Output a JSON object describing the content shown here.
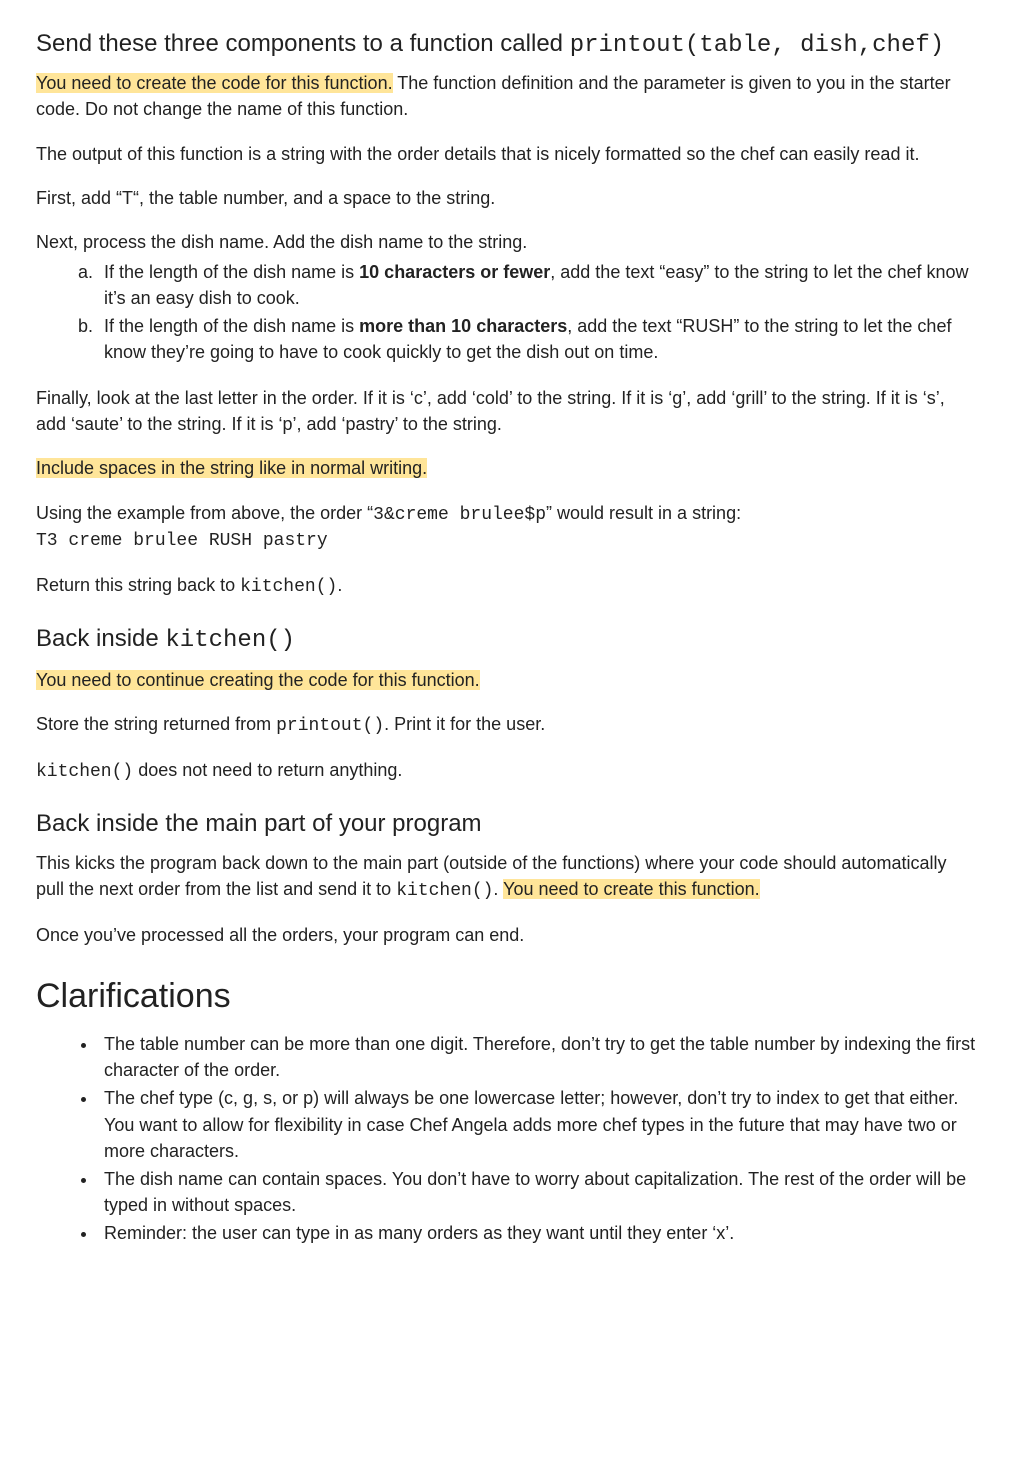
{
  "section1": {
    "title_pre": "Send these three components to a function called ",
    "title_code": "printout(table, dish,chef)",
    "p1_hl": "You need to create the code for this function.",
    "p1_rest": " The function definition and the parameter is given to you in the starter code. Do not change the name of this function.",
    "p2": "The output of this function is a string with the order details that is nicely formatted so the chef can easily read it.",
    "p3": "First, add “T“, the table number, and a space to the string.",
    "p4": "Next, process the dish name. Add the dish name to the string.",
    "li_a_pre": "If the length of the dish name is ",
    "li_a_bold": "10 characters or fewer",
    "li_a_post": ", add the text “easy” to the string to let the chef know it’s an easy dish to cook.",
    "li_b_pre": "If the length of the dish name is ",
    "li_b_bold": "more than 10 characters",
    "li_b_post": ", add the text “RUSH” to the string to let the chef know they’re going to have to cook quickly to get the dish out on time.",
    "p5": "Finally, look at the last letter in the order. If it is ‘c’, add ‘cold’ to the string. If it is ‘g’, add ‘grill’ to the string. If it is ‘s’, add ‘saute’ to the string. If it is ‘p’, add ‘pastry’ to the string.",
    "p6_hl": "Include spaces in the string like in normal writing.",
    "p7_pre": "Using the example from above, the order “",
    "p7_code": "3&creme brulee$p",
    "p7_post": "” would result in a string:",
    "p7_out": "T3 creme brulee RUSH pastry",
    "p8_pre": "Return this string back to ",
    "p8_code": "kitchen()",
    "p8_post": "."
  },
  "section2": {
    "title_pre": "Back inside ",
    "title_code": "kitchen()",
    "p1_hl": "You need to continue creating the code for this function.",
    "p2_pre": "Store the string returned from ",
    "p2_code": "printout()",
    "p2_post": ". Print it for the user.",
    "p3_code": "kitchen()",
    "p3_post": " does not need to return anything."
  },
  "section3": {
    "title": "Back inside the main part of your program",
    "p1_pre": "This kicks the program back down to the main part (outside of the functions) where your code should automatically pull the next order from the list and send it to ",
    "p1_code": "kitchen()",
    "p1_mid": ". ",
    "p1_hl": "You need to create this function.",
    "p2": "Once you’ve processed all the orders, your program can end."
  },
  "clar": {
    "title": "Clarifications",
    "items": [
      "The table number can be more than one digit. Therefore, don’t try to get the table number by indexing the first character of the order.",
      "The chef type (c, g, s, or p) will always be one lowercase letter; however, don’t try to index to get that either. You want to allow for flexibility in case Chef Angela adds more chef types in the future that may have two or more characters.",
      "The dish name can contain spaces. You don’t have to worry about capitalization. The rest of the order will be typed in without spaces.",
      "Reminder: the user can type in as many orders as they want until they enter ‘x’."
    ]
  }
}
